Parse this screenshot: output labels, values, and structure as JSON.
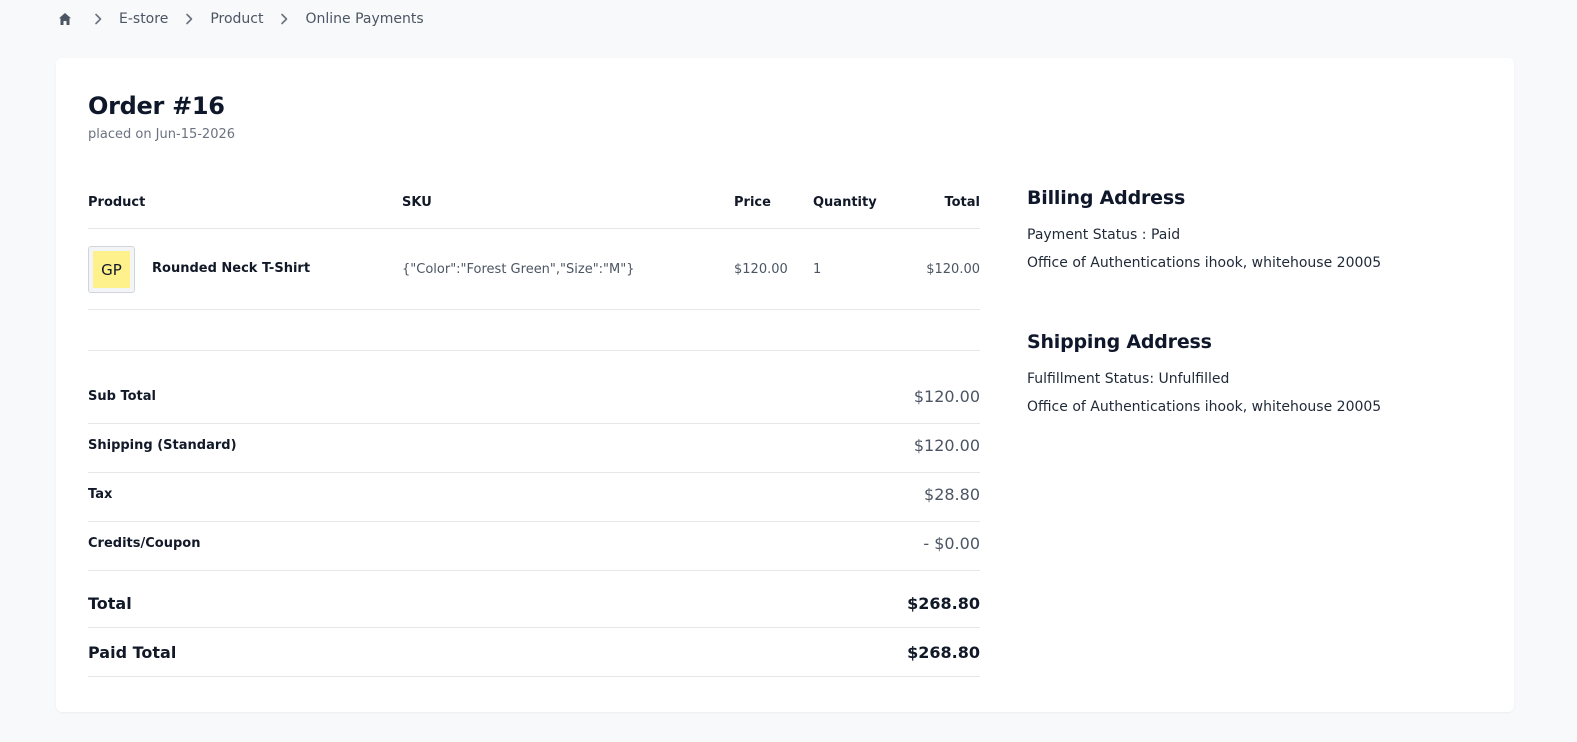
{
  "breadcrumb": {
    "home_icon": "home-icon",
    "items": [
      "E-store",
      "Product",
      "Online Payments"
    ]
  },
  "order": {
    "title": "Order #16",
    "placed": "placed on Jun-15-2026"
  },
  "table": {
    "headers": {
      "product": "Product",
      "sku": "SKU",
      "price": "Price",
      "quantity": "Quantity",
      "total": "Total"
    },
    "rows": [
      {
        "thumb_text": "GP",
        "thumb_color": "#fef08a",
        "name": "Rounded Neck T-Shirt",
        "sku": "{\"Color\":\"Forest Green\",\"Size\":\"M\"}",
        "price": "$120.00",
        "quantity": "1",
        "total": "$120.00"
      }
    ]
  },
  "summary": {
    "sub_total_label": "Sub Total",
    "sub_total_value": "$120.00",
    "shipping_label": "Shipping (Standard)",
    "shipping_value": "$120.00",
    "tax_label": "Tax",
    "tax_value": "$28.80",
    "credits_label": "Credits/Coupon",
    "credits_value": "- $0.00",
    "total_label": "Total",
    "total_value": "$268.80",
    "paid_total_label": "Paid Total",
    "paid_total_value": "$268.80"
  },
  "billing": {
    "title": "Billing Address",
    "status": "Payment Status : Paid",
    "address": "Office of Authentications ihook, whitehouse 20005"
  },
  "shipping": {
    "title": "Shipping Address",
    "status": "Fulfillment Status: Unfulfilled",
    "address": "Office of Authentications ihook, whitehouse 20005"
  }
}
